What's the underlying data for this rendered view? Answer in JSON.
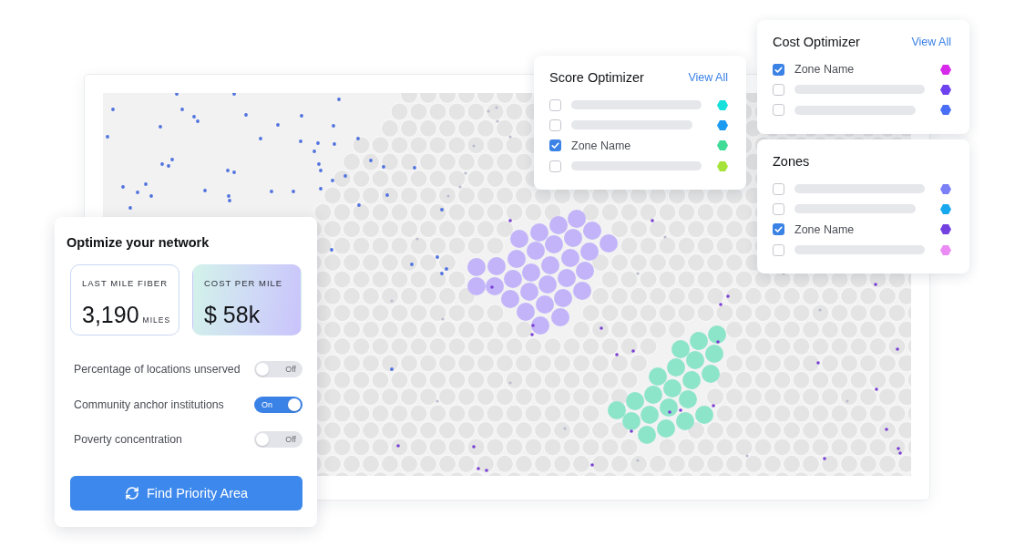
{
  "legend_panels": [
    {
      "title": "Score Optimizer",
      "link": "View All",
      "items": [
        {
          "kind": "placeholder",
          "checked": false,
          "color": "#16e0dc"
        },
        {
          "kind": "placeholder",
          "checked": false,
          "color": "#1d9bf0"
        },
        {
          "kind": "label",
          "label": "Zone Name",
          "checked": true,
          "color": "#3fdb97"
        },
        {
          "kind": "placeholder",
          "checked": false,
          "color": "#a6e33a"
        }
      ]
    },
    {
      "title": "Cost Optimizer",
      "link": "View All",
      "items": [
        {
          "kind": "label",
          "label": "Zone Name",
          "checked": true,
          "color": "#d629ea"
        },
        {
          "kind": "placeholder",
          "checked": false,
          "color": "#6f42ef"
        },
        {
          "kind": "placeholder",
          "checked": false,
          "color": "#4a6ef6"
        }
      ]
    },
    {
      "title": "Zones",
      "items": [
        {
          "kind": "placeholder",
          "checked": false,
          "color": "#7b80f7"
        },
        {
          "kind": "placeholder",
          "checked": false,
          "color": "#18a8f0"
        },
        {
          "kind": "label",
          "label": "Zone Name",
          "checked": true,
          "color": "#7241e0"
        },
        {
          "kind": "placeholder",
          "checked": false,
          "color": "#ea8cf4"
        }
      ]
    }
  ],
  "optimize_panel": {
    "title": "Optimize your network",
    "metrics": [
      {
        "label": "LAST MILE FIBER",
        "value": "3,190",
        "unit": "MILES",
        "highlighted": false
      },
      {
        "label": "COST PER MILE",
        "value": "$ 58k",
        "highlighted": true
      }
    ],
    "toggles": [
      {
        "label": "Percentage of locations unserved",
        "on": false,
        "state_text": "Off"
      },
      {
        "label": "Community anchor institutions",
        "on": true,
        "state_text": "On"
      },
      {
        "label": "Poverty concentration",
        "on": false,
        "state_text": "Off"
      }
    ],
    "action_button": {
      "label": "Find Priority Area"
    }
  }
}
